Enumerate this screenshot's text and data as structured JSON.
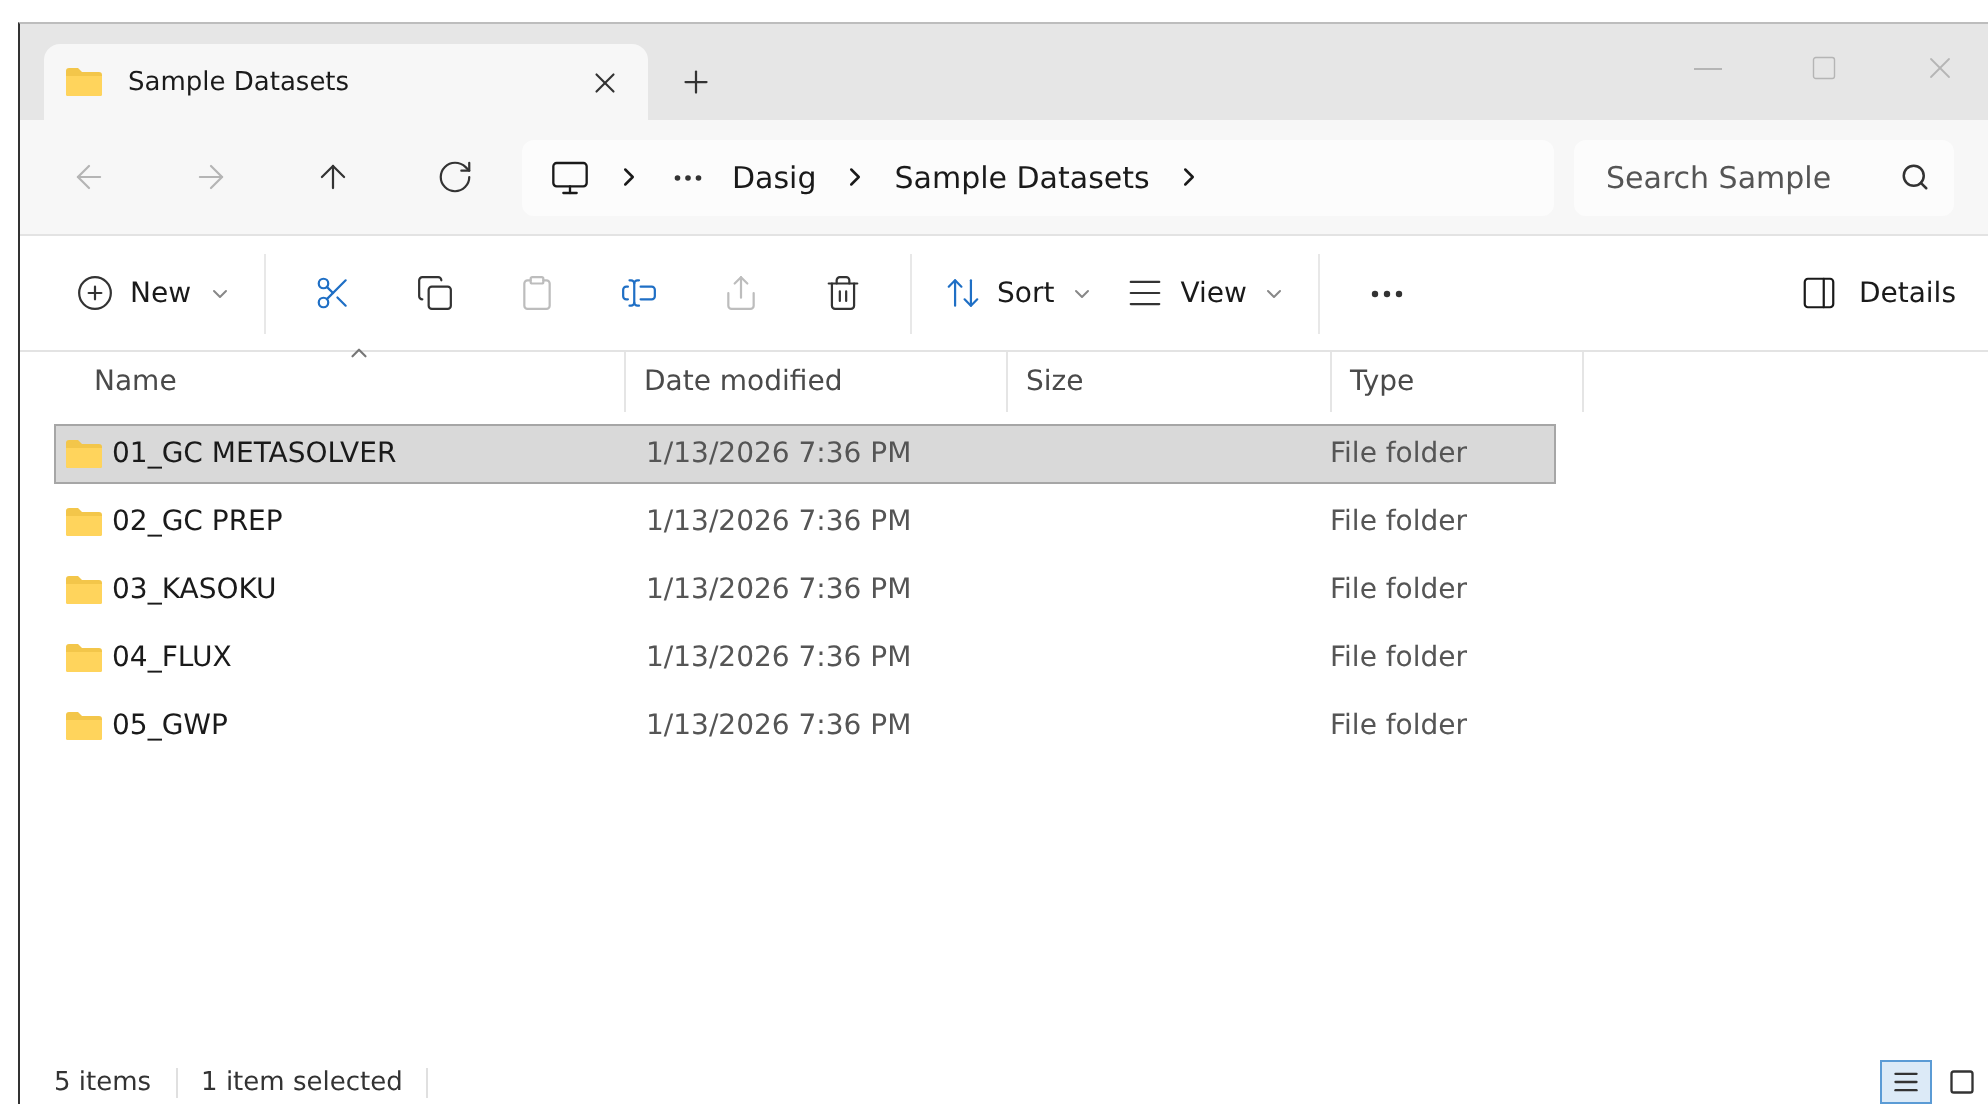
{
  "tabs": [
    {
      "title": "Sample Datasets",
      "selected": true
    }
  ],
  "nav": [
    {
      "kind": "back",
      "disabled": true
    },
    {
      "kind": "forward",
      "disabled": true
    },
    {
      "kind": "up",
      "disabled": false
    },
    {
      "kind": "refresh",
      "disabled": false
    }
  ],
  "breadcrumbs": [
    "Dasig",
    "Sample Datasets"
  ],
  "search": {
    "placeholder": "Search Sample"
  },
  "toolbar": [
    {
      "kind": "new",
      "label": "New",
      "disabled": false
    },
    {
      "kind": "cut",
      "disabled": false
    },
    {
      "kind": "copy",
      "disabled": false
    },
    {
      "kind": "paste",
      "disabled": true
    },
    {
      "kind": "rename",
      "disabled": false
    },
    {
      "kind": "share",
      "disabled": true
    },
    {
      "kind": "delete",
      "disabled": false
    },
    {
      "kind": "sort",
      "label": "Sort",
      "disabled": false
    },
    {
      "kind": "view",
      "label": "View",
      "disabled": false
    },
    {
      "kind": "more",
      "disabled": false
    }
  ],
  "details_button": "Details",
  "columns": [
    "Name",
    "Date modified",
    "Size",
    "Type"
  ],
  "rows": [
    {
      "name": "01_GC METASOLVER",
      "date": "1/13/2026 7:36 PM",
      "type": "File folder",
      "selected": true
    },
    {
      "name": "02_GC PREP",
      "date": "1/13/2026 7:36 PM",
      "type": "File folder",
      "selected": false
    },
    {
      "name": "03_KASOKU",
      "date": "1/13/2026 7:36 PM",
      "type": "File folder",
      "selected": false
    },
    {
      "name": "04_FLUX",
      "date": "1/13/2026 7:36 PM",
      "type": "File folder",
      "selected": false
    },
    {
      "name": "05_GWP",
      "date": "1/13/2026 7:36 PM",
      "type": "File folder",
      "selected": false
    }
  ],
  "status_bar": {
    "item_count": "5 items",
    "selection": "1 item selected"
  },
  "view_modes": [
    {
      "kind": "details",
      "selected": true
    },
    {
      "kind": "tiles",
      "selected": false
    }
  ]
}
